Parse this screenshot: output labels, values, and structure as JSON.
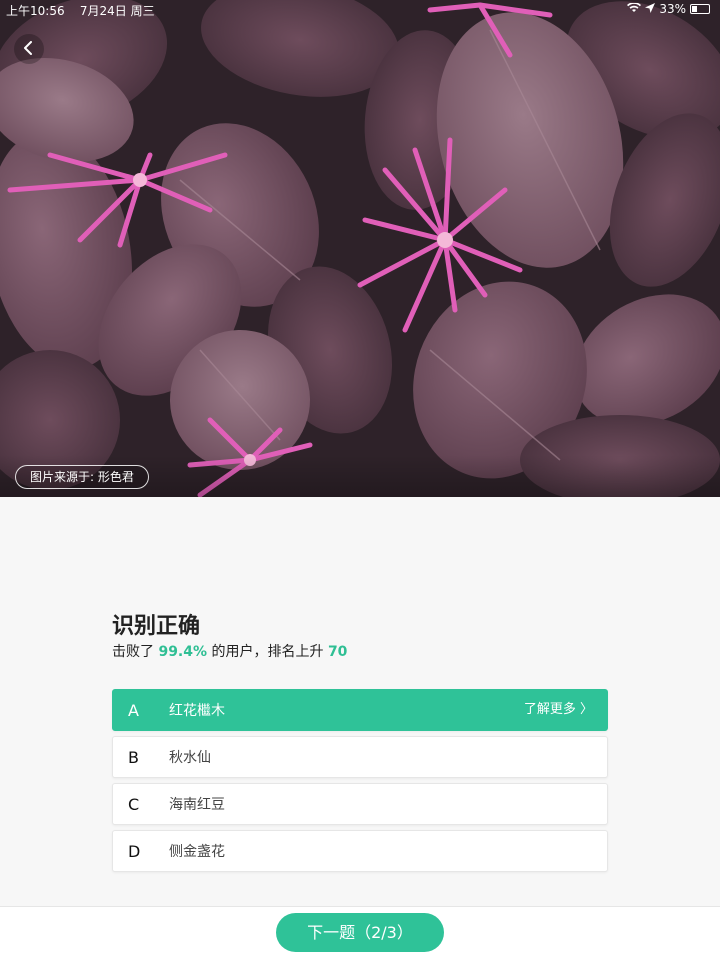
{
  "status_bar": {
    "time": "上午10:56",
    "date": "7月24日 周三",
    "battery": "33%"
  },
  "photo": {
    "source_label": "图片来源于: 形色君",
    "subject": "loropetalum-flower-photo"
  },
  "result": {
    "title": "识别正确",
    "sub_prefix": "击败了 ",
    "percent": "99.4%",
    "sub_middle": " 的用户，排名上升 ",
    "rank_up": "70"
  },
  "options": [
    {
      "letter": "A",
      "label": "红花檵木",
      "more": "了解更多 〉",
      "correct": true
    },
    {
      "letter": "B",
      "label": "秋水仙"
    },
    {
      "letter": "C",
      "label": "海南红豆"
    },
    {
      "letter": "D",
      "label": "侧金盏花"
    }
  ],
  "footer": {
    "next_label": "下一题（2/3）"
  },
  "colors": {
    "accent": "#2fc298",
    "background": "#f7f7f7"
  }
}
